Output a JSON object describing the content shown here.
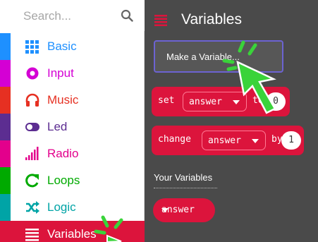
{
  "search": {
    "placeholder": "Search..."
  },
  "categories": [
    {
      "label": "Basic",
      "color": "#1e90ff",
      "icon": "grid-icon"
    },
    {
      "label": "Input",
      "color": "#d400d4",
      "icon": "input-target-icon"
    },
    {
      "label": "Music",
      "color": "#e63022",
      "icon": "headphones-icon"
    },
    {
      "label": "Led",
      "color": "#5c2d91",
      "icon": "toggle-icon"
    },
    {
      "label": "Radio",
      "color": "#e3008c",
      "icon": "signal-bars-icon"
    },
    {
      "label": "Loops",
      "color": "#00aa00",
      "icon": "loop-arrow-icon"
    },
    {
      "label": "Logic",
      "color": "#00a4a6",
      "icon": "shuffle-icon"
    },
    {
      "label": "Variables",
      "color": "#dc143c",
      "icon": "list-icon",
      "selected": true
    }
  ],
  "flyout": {
    "title": "Variables",
    "make_variable_label": "Make a Variable...",
    "set_block": {
      "keyword": "set",
      "variable": "answer",
      "to": "to",
      "value": "0"
    },
    "change_block": {
      "keyword": "change",
      "variable": "answer",
      "by": "by",
      "value": "1"
    },
    "your_variables_label": "Your Variables",
    "variables": [
      "answer"
    ]
  },
  "colors": {
    "variables": "#dc143c",
    "flyout_background": "#4a4a4a",
    "pointer": "#3ad33a"
  }
}
